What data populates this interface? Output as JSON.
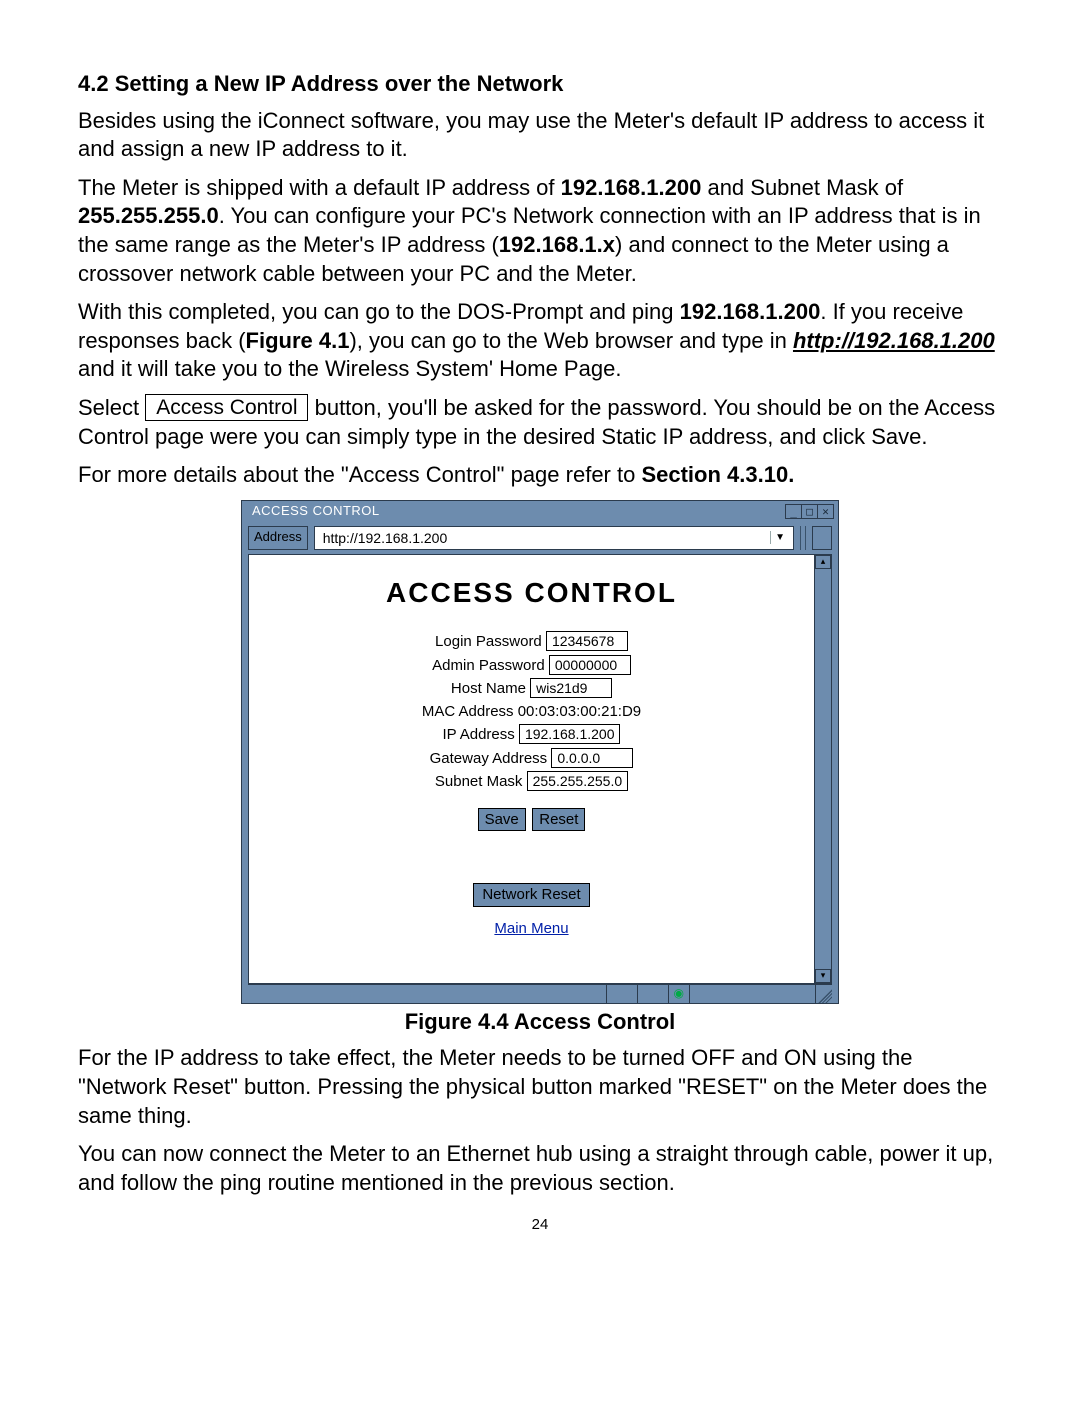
{
  "section_title": "4.2 Setting a New IP Address over the Network",
  "p1": "Besides using the iConnect software, you may use the Meter's default IP address to access it and assign a new IP address to it.",
  "p2": {
    "a": "The Meter is shipped with a default IP address of ",
    "ip1": "192.168.1.200",
    "b": " and Subnet Mask of ",
    "mask": "255.255.255.0",
    "c": ".  You can configure your PC's Network connection with an IP address that is in the same range as the Meter's IP address (",
    "range": "192.168.1.x",
    "d": ") and connect to the Meter using a crossover network cable between your PC and the Meter."
  },
  "p3": {
    "a": "With this completed, you can go to the DOS-Prompt and ping ",
    "ip": "192.168.1.200",
    "b": ". If you receive responses back (",
    "fig": "Figure 4.1",
    "c": "), you can go to the Web browser and type in ",
    "url": "http://192.168.1.200",
    "d": " and it will take you to the Wireless System' Home Page."
  },
  "p4": {
    "a": "Select ",
    "btn": " Access Control ",
    "b": " button, you'll be asked for the password. You should be on the Access Control page were you can simply type in the desired Static IP address, and click Save."
  },
  "p5": {
    "a": "For more details about the \"Access Control\" page refer to ",
    "sec": "Section 4.3.10."
  },
  "browser": {
    "title": "ACCESS CONTROL",
    "address_label": "Address",
    "address_url": "http://192.168.1.200",
    "heading": "ACCESS CONTROL",
    "labels": {
      "login": "Login Password",
      "admin": "Admin Password",
      "host": "Host Name",
      "mac_label": "MAC Address",
      "mac_value": "00:03:03:00:21:D9",
      "ip": "IP Address",
      "gw": "Gateway Address",
      "sn": "Subnet Mask"
    },
    "values": {
      "login": "12345678",
      "admin": "00000000",
      "host": " wis21d9",
      "ip": "192.168.1.200",
      "gw": "0.0.0.0",
      "sn": "255.255.255.0"
    },
    "buttons": {
      "save": "Save",
      "reset": "Reset",
      "network_reset": "Network Reset",
      "main_menu": "Main Menu"
    }
  },
  "caption": "Figure 4.4  Access Control",
  "p6": "For the IP address to take effect, the Meter needs to be turned OFF and ON using the \"Network Reset\" button. Pressing the physical button marked \"RESET\" on the Meter does the same thing.",
  "p7": "You can now connect the Meter to an Ethernet hub using a straight through cable, power it up, and follow the ping routine mentioned in the previous section.",
  "page_number": "24"
}
